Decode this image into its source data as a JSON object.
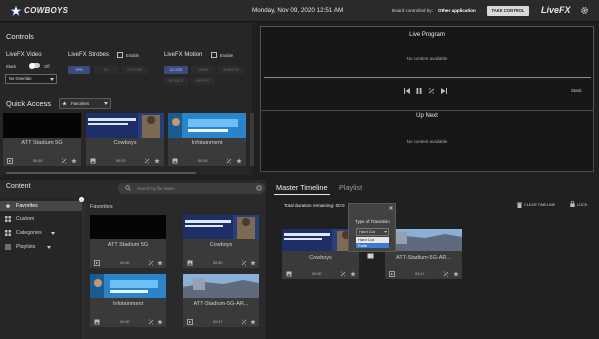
{
  "topbar": {
    "logo_text": "COWBOYS",
    "datetime": "Monday, Nov 09, 2020  12:51 AM",
    "controlled_label": "Board controlled by:",
    "controlled_app": "Other application",
    "take_control": "TAKE CONTROL",
    "brand": "LiveFX"
  },
  "controls": {
    "title": "Controls",
    "video": {
      "title": "LiveFX Video",
      "black_label": "Black",
      "off_label": "Off",
      "override_value": "No Override"
    },
    "strobes": {
      "title": "LiveFX Strobes",
      "enable_label": "Enable",
      "options": [
        "SPR",
        "SD",
        "STROBE"
      ]
    },
    "motion": {
      "title": "LiveFX Motion",
      "enable_label": "Enable",
      "options": [
        "CLOSE",
        "OPEN",
        "INVERSE",
        "ROTATE",
        "RIPPLE"
      ]
    }
  },
  "quick_access": {
    "title": "Quick Access",
    "dropdown_value": "Favorites",
    "cards": [
      {
        "name": "ATT Stadium 5G",
        "time": "00:30"
      },
      {
        "name": "Cowboys",
        "time": "00:20"
      },
      {
        "name": "Infotainment",
        "time": "00:30"
      }
    ]
  },
  "live_program": {
    "title": "Live Program",
    "empty_text": "No content available",
    "static_label": "Static"
  },
  "up_next": {
    "title": "Up Next",
    "empty_text": "No content available"
  },
  "content": {
    "title": "Content",
    "search_placeholder": "Search by file Name",
    "sidebar": [
      {
        "label": "Favorites",
        "icon": "star-icon"
      },
      {
        "label": "Custom",
        "icon": "grid-icon"
      },
      {
        "label": "Categories",
        "icon": "grid-icon"
      },
      {
        "label": "Playlists",
        "icon": "list-icon"
      }
    ],
    "section_title": "Favorites",
    "cards": [
      {
        "name": "ATT Stadium 5G",
        "time": "00:30"
      },
      {
        "name": "Cowboys",
        "time": "00:30"
      },
      {
        "name": "Infotainment",
        "time": "00:30"
      },
      {
        "name": "ATT-Stadium-5G-AR...",
        "time": "00:47"
      }
    ]
  },
  "timeline": {
    "tab_master": "Master Timeline",
    "tab_playlist": "Playlist",
    "duration_label": "Total duration remaining: 00:0",
    "clear_label": "CLEAR TIMELINE",
    "lock_label": "LOCK",
    "cards": [
      {
        "name": "Cowboys",
        "time": "00:30"
      },
      {
        "name": "ATT-Stadium-5G-AR...",
        "time": "00:47"
      }
    ],
    "popup": {
      "title": "Type of Transition",
      "selected": "Hard Cut",
      "options": [
        "Hard Cut",
        "Fade"
      ]
    }
  }
}
